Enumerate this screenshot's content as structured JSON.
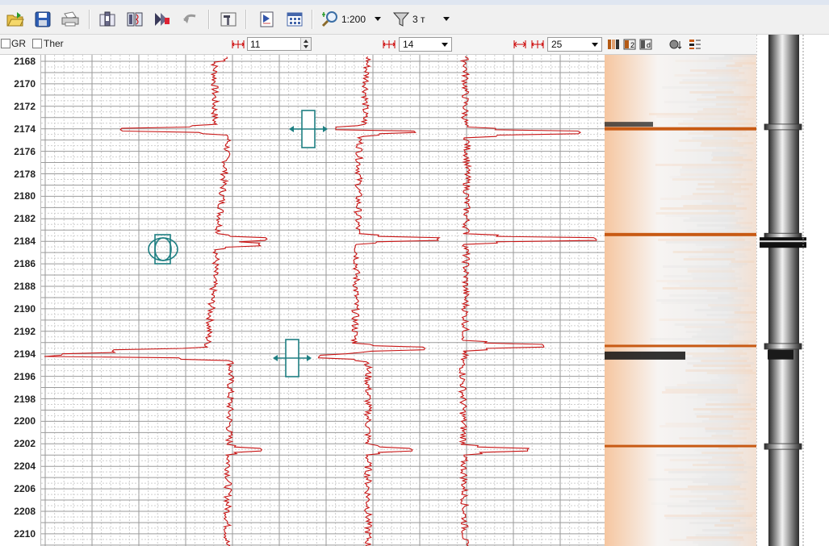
{
  "toolbar": {
    "icons": [
      "open-folder-icon",
      "save-icon",
      "print-icon",
      "tool-settings-icon",
      "log-tracks-icon",
      "curve-edit-icon",
      "undo-icon",
      "properties-icon",
      "template-icon",
      "grid-table-icon",
      "zoom-icon",
      "filter-icon"
    ],
    "scale_value": "1:200",
    "filter_value": "3 т"
  },
  "controls": {
    "gr_label": "GR",
    "ther_label": "Ther",
    "spin1_value": "11",
    "dd2_value": "14",
    "dd3_value": "25",
    "t_label": "т"
  },
  "depth": {
    "labels": [
      "2168",
      "2170",
      "2172",
      "2174",
      "2176",
      "2178",
      "2180",
      "2182",
      "2184",
      "2186",
      "2188",
      "2190",
      "2192",
      "2194",
      "2196",
      "2198",
      "2200",
      "2202",
      "2204",
      "2206",
      "2208",
      "2210"
    ]
  },
  "colors": {
    "curve": "#c81414",
    "marker": "#1e7f82",
    "band": "#c85a14",
    "grid_major": "#9a9a9a",
    "grid_minor": "#cfcfcf"
  }
}
